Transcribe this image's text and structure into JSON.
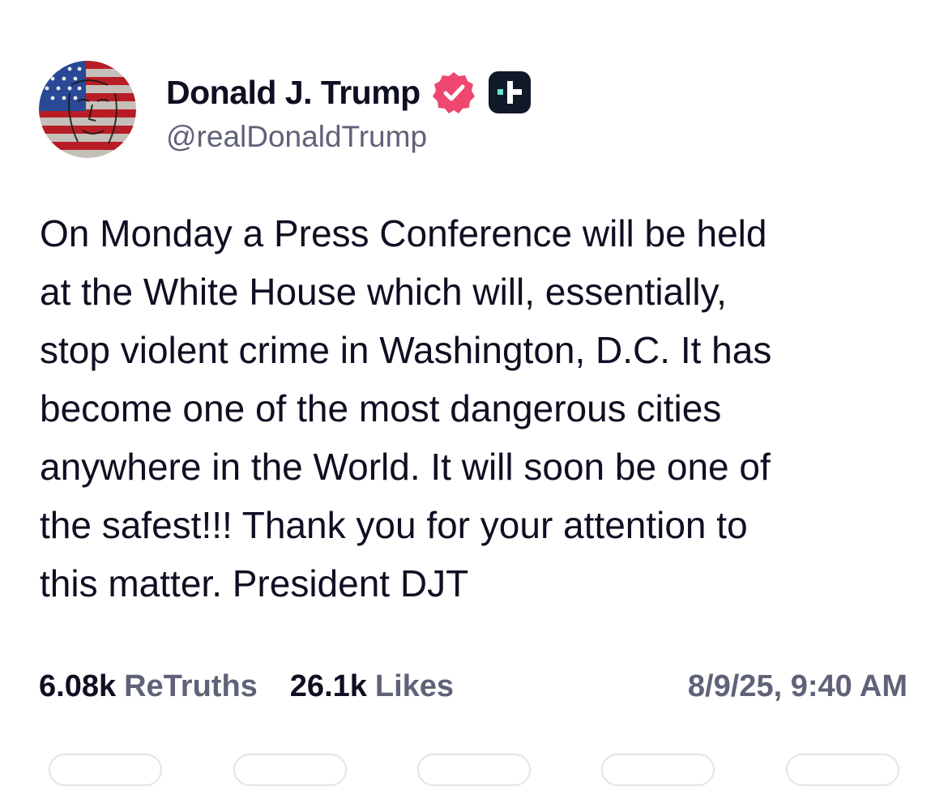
{
  "post": {
    "author": {
      "display_name": "Donald J. Trump",
      "handle": "@realDonaldTrump",
      "avatar_icon": "flag-portrait-avatar",
      "verified_icon": "verified-badge-icon",
      "verified_color": "#ef476f",
      "plus_icon": "truth-plus-icon",
      "plus_badge_color": "#111827",
      "plus_accent_color": "#5ee6c8"
    },
    "text": "On Monday a Press Conference will be held\nat the White House which will, essentially,\nstop violent crime in Washington, D.C. It has\nbecome one of the most dangerous cities\nanywhere in the World. It will soon be one of\nthe safest!!! Thank you for your attention to\nthis matter. President DJT",
    "stats": {
      "retruths_count": "6.08k",
      "retruths_label": "ReTruths",
      "likes_count": "26.1k",
      "likes_label": "Likes"
    },
    "timestamp": "8/9/25, 9:40 AM"
  },
  "colors": {
    "text_primary": "#0f0f23",
    "text_secondary": "#5f6278",
    "background": "#ffffff"
  }
}
